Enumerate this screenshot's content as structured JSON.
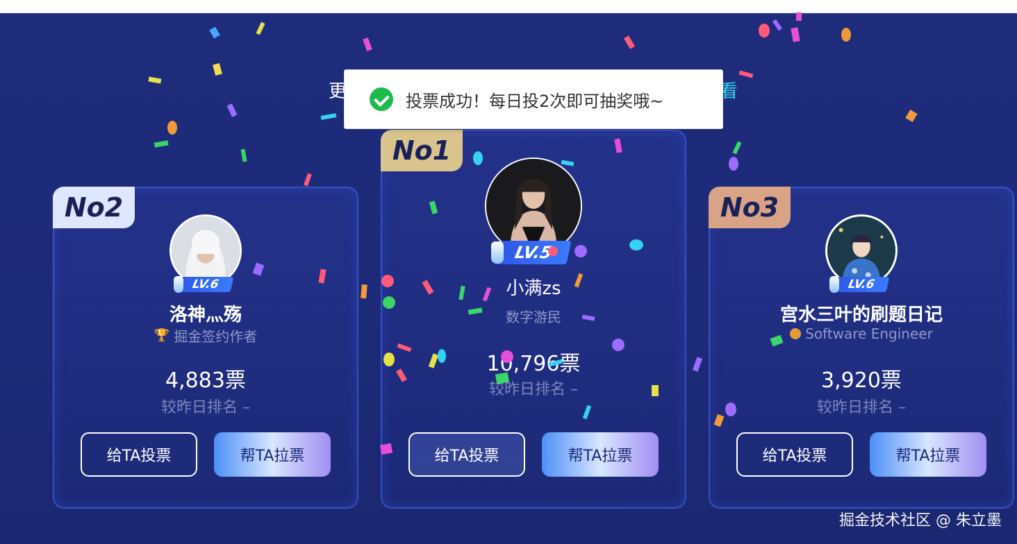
{
  "header": {
    "subtitle_left": "更",
    "subtitle_right": "看"
  },
  "toast": {
    "message": "投票成功！每日投2次即可抽奖哦~"
  },
  "cards": [
    {
      "rank": "No2",
      "level": "LV.6",
      "name": "洛神灬殇",
      "title": "掘金签约作者",
      "votes": "4,883票",
      "rank_change": "较昨日排名 –",
      "vote_button": "给TA投票",
      "pull_button": "帮TA拉票"
    },
    {
      "rank": "No1",
      "level": "LV.5",
      "name": "小满zs",
      "title": "数字游民",
      "votes": "10,796票",
      "rank_change": "较昨日排名 –",
      "vote_button": "给TA投票",
      "pull_button": "帮TA拉票"
    },
    {
      "rank": "No3",
      "level": "LV.6",
      "name": "宫水三叶的刷题日记",
      "title": "Software Engineer",
      "votes": "3,920票",
      "rank_change": "较昨日排名 –",
      "vote_button": "给TA投票",
      "pull_button": "帮TA拉票"
    }
  ],
  "watermark": "掘金技术社区 @ 朱立墨"
}
